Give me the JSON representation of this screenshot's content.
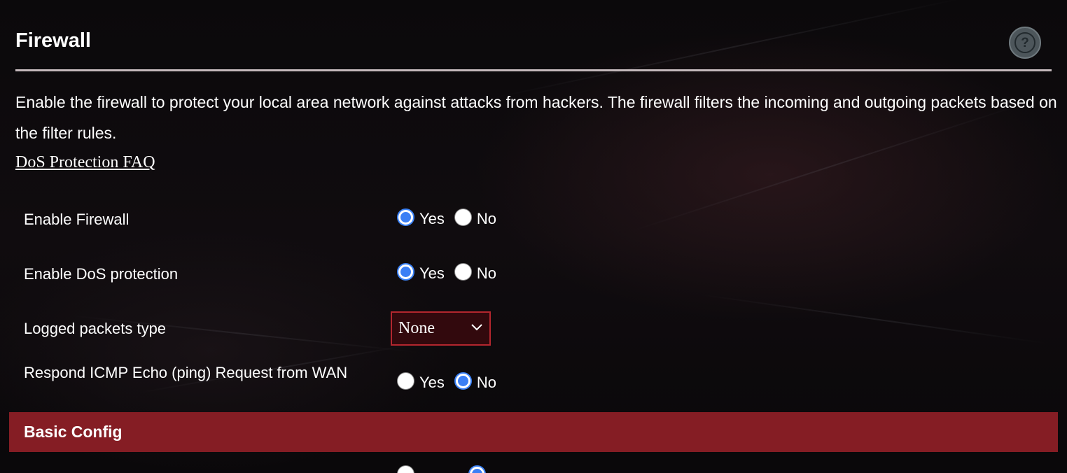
{
  "page": {
    "title": "Firewall",
    "help_icon": "question-mark-icon",
    "description": "Enable the firewall to protect your local area network against attacks from hackers. The firewall filters the incoming and outgoing packets based on the filter rules.",
    "faq_link": "DoS Protection FAQ"
  },
  "settings": {
    "enable_firewall": {
      "label": "Enable Firewall",
      "yes_label": "Yes",
      "no_label": "No",
      "selected": "Yes"
    },
    "enable_dos": {
      "label": "Enable DoS protection",
      "yes_label": "Yes",
      "no_label": "No",
      "selected": "Yes"
    },
    "logged_packets": {
      "label": "Logged packets type",
      "value": "None"
    },
    "respond_icmp": {
      "label": "Respond ICMP Echo (ping) Request from WAN",
      "yes_label": "Yes",
      "no_label": "No",
      "selected": "No"
    }
  },
  "section": {
    "title": "Basic Config"
  },
  "colors": {
    "background": "#0c0a0c",
    "accent_red": "#851d24",
    "select_border": "#b3262e",
    "radio_blue": "#3b7ff5"
  }
}
